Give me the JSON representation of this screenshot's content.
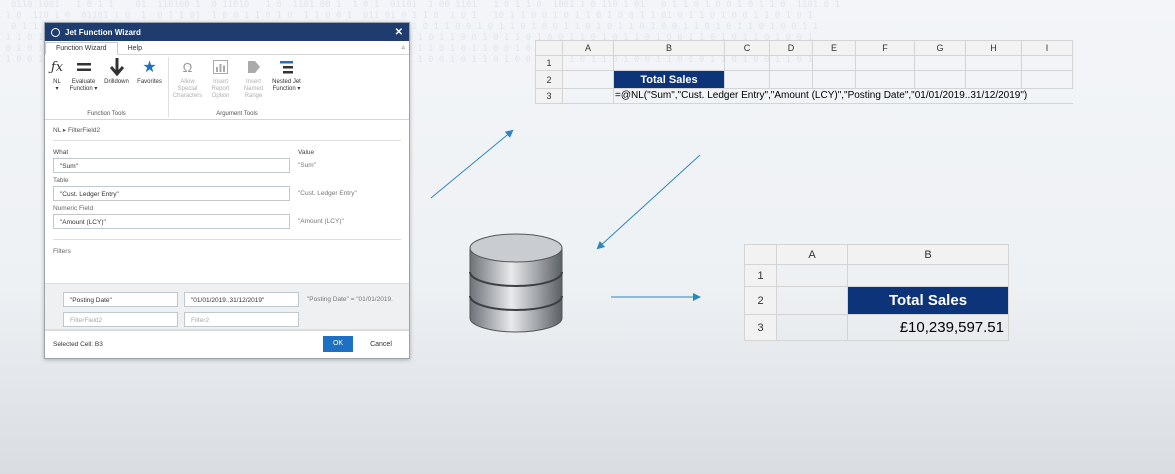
{
  "dialog": {
    "title": "Jet Function Wizard",
    "tabs": [
      "Function Wizard",
      "Help"
    ],
    "ribbon": {
      "function_tools": {
        "label": "Function Tools",
        "items": [
          {
            "label": "NL",
            "sub": "▾",
            "icon": "fx-icon"
          },
          {
            "label": "Evaluate",
            "sub": "Function ▾",
            "icon": "equals-icon"
          },
          {
            "label": "Drilldown",
            "sub": "",
            "icon": "arrow-down-icon"
          },
          {
            "label": "Favorites",
            "sub": "",
            "icon": "star-icon"
          }
        ]
      },
      "argument_tools": {
        "label": "Argument Tools",
        "items": [
          {
            "label": "Allow Special",
            "sub": "Characters",
            "icon": "omega-icon"
          },
          {
            "label": "Insert Report",
            "sub": "Option",
            "icon": "report-chart-icon"
          },
          {
            "label": "Insert Named",
            "sub": "Range",
            "icon": "tag-icon"
          },
          {
            "label": "Nested Jet",
            "sub": "Function ▾",
            "icon": "nested-lines-icon"
          }
        ]
      }
    },
    "breadcrumb": "NL  ▸  FilterField2",
    "headers": {
      "what": "What",
      "value": "Value"
    },
    "fields": [
      {
        "label": "",
        "value": "\"Sum\"",
        "preview": "\"Sum\""
      },
      {
        "label": "Table",
        "value": "\"Cust. Ledger Entry\"",
        "preview": "\"Cust. Ledger Entry\""
      },
      {
        "label": "Numeric Field",
        "value": "\"Amount (LCY)\"",
        "preview": "\"Amount (LCY)\""
      }
    ],
    "filters_label": "Filters",
    "filters": {
      "field1": "\"Posting Date\"",
      "filter1": "\"01/01/2019..31/12/2019\"",
      "preview1": "\"Posting Date\" = \"01/01/2019.",
      "field2_placeholder": "FilterField2",
      "filter2_placeholder": "Filter2"
    },
    "selected_cell": "Selected Cell: B3",
    "ok": "OK",
    "cancel": "Cancel"
  },
  "sheet_top": {
    "columns": [
      "A",
      "B",
      "C",
      "D",
      "E",
      "F",
      "G",
      "H",
      "I"
    ],
    "rows": [
      "1",
      "2",
      "3"
    ],
    "b2": "Total Sales",
    "formula": "=@NL(\"Sum\",\"Cust. Ledger Entry\",\"Amount (LCY)\",\"Posting Date\",\"01/01/2019..31/12/2019\")"
  },
  "sheet_bottom": {
    "columns": [
      "A",
      "B"
    ],
    "rows": [
      "1",
      "2",
      "3"
    ],
    "b2": "Total Sales",
    "b3": "£10,239,597.51"
  },
  "colors": {
    "title_bar": "#1f3c6e",
    "ok_button": "#1d70c4",
    "total_sales_fill": "#0d3478",
    "arrow": "#2e86c1"
  }
}
